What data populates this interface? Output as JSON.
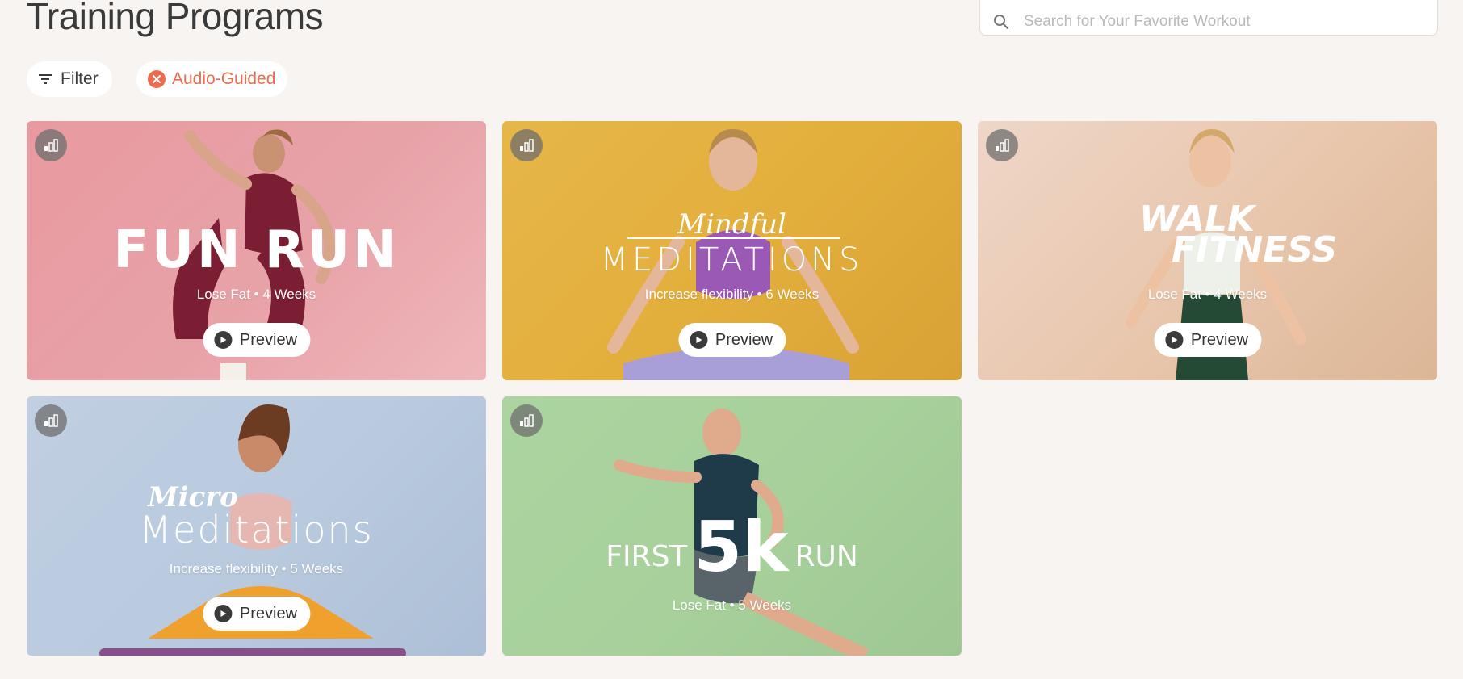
{
  "header": {
    "title": "Training Programs",
    "search_placeholder": "Search for Your Favorite Workout"
  },
  "filters": {
    "filter_label": "Filter",
    "active_chip_label": "Audio-Guided"
  },
  "colors": {
    "accent": "#ef6b4f",
    "background": "#f8f4f1"
  },
  "programs": [
    {
      "logo": "FUN RUN",
      "subtitle": "Lose Fat • 4 Weeks",
      "preview_label": "Preview",
      "bg": "#e89aa0"
    },
    {
      "logo_script": "Mindful",
      "logo": "MEDITATIONS",
      "subtitle": "Increase flexibility • 6 Weeks",
      "preview_label": "Preview",
      "bg": "#e4b040"
    },
    {
      "logo_line1": "WALK",
      "logo_line2": "FITNESS",
      "subtitle": "Lose Fat • 4 Weeks",
      "preview_label": "Preview",
      "bg": "#e9c9b0"
    },
    {
      "logo_script": "Micro",
      "logo": "Meditations",
      "subtitle": "Increase flexibility • 5 Weeks",
      "preview_label": "Preview",
      "bg": "#b9cadf"
    },
    {
      "logo_pre": "FIRST",
      "logo_big": "5k",
      "logo_post": "RUN",
      "subtitle": "Lose Fat • 5 Weeks",
      "bg": "#a7d09b"
    }
  ]
}
